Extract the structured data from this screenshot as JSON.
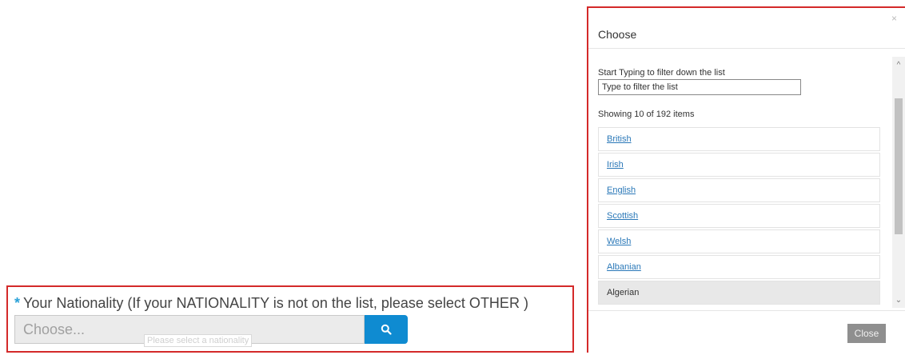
{
  "form": {
    "required_mark": "*",
    "label": "Your Nationality (If your NATIONALITY is not on the list, please select OTHER )",
    "input_placeholder": "Choose...",
    "tooltip": "Please select a nationality",
    "search_icon": "search-icon",
    "colors": {
      "accent": "#0f8bd1",
      "required": "#2aa1d8",
      "highlight_border": "#d42a2a"
    }
  },
  "modal": {
    "title": "Choose",
    "close_x": "×",
    "filter_label": "Start Typing to filter down the list",
    "filter_placeholder": "Type to filter the list",
    "showing": "Showing 10 of 192 items",
    "items": [
      {
        "label": "British"
      },
      {
        "label": "Irish"
      },
      {
        "label": "English"
      },
      {
        "label": "Scottish"
      },
      {
        "label": "Welsh"
      },
      {
        "label": "Albanian"
      },
      {
        "label": "Algerian"
      }
    ],
    "close_button": "Close"
  }
}
